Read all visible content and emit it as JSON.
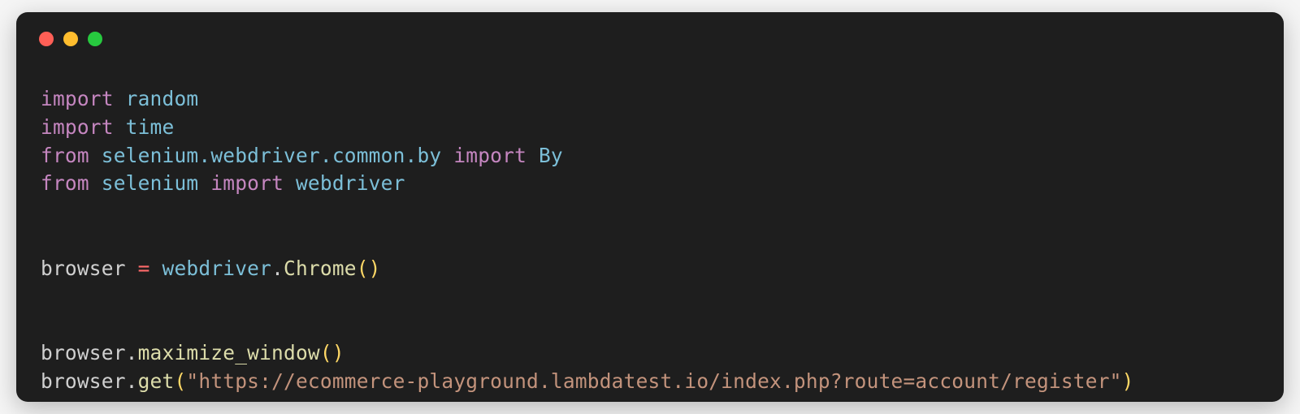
{
  "code": {
    "line1": {
      "kw": "import",
      "mod": "random"
    },
    "line2": {
      "kw": "import",
      "mod": "time"
    },
    "line3": {
      "kw1": "from",
      "path": "selenium.webdriver.common.by",
      "kw2": "import",
      "name": "By"
    },
    "line4": {
      "kw1": "from",
      "path": "selenium",
      "kw2": "import",
      "name": "webdriver"
    },
    "line5": {
      "var": "browser",
      "op": "=",
      "obj": "webdriver",
      "call": "Chrome"
    },
    "line6": {
      "obj": "browser",
      "call": "maximize_window"
    },
    "line7": {
      "obj": "browser",
      "call": "get",
      "arg": "\"https://ecommerce-playground.lambdatest.io/index.php?route=account/register\""
    }
  }
}
